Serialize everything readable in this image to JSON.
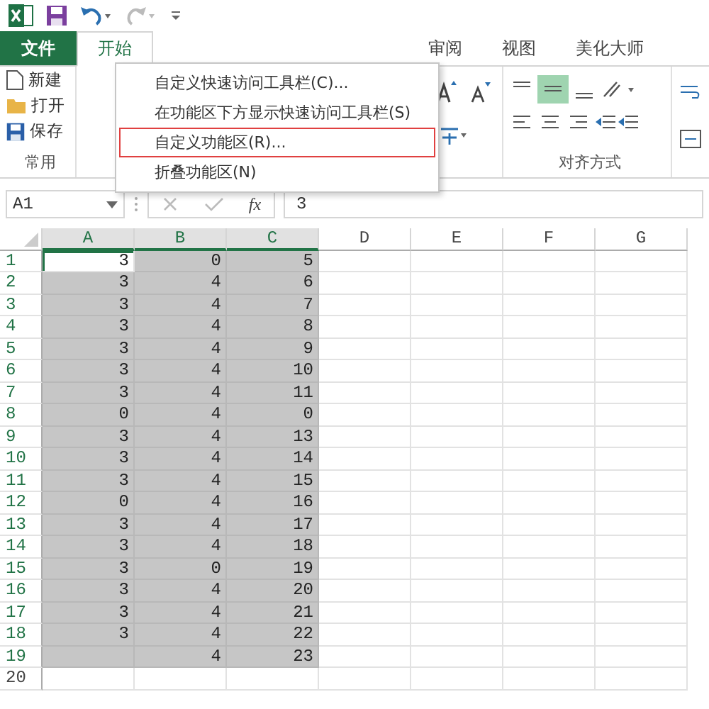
{
  "tabs": [
    {
      "label": "文件",
      "kind": "file",
      "selected": false
    },
    {
      "label": "开始",
      "kind": "tab",
      "selected": true
    },
    {
      "label": "审阅",
      "kind": "tab",
      "selected": false
    },
    {
      "label": "视图",
      "kind": "tab",
      "selected": false
    },
    {
      "label": "美化大师",
      "kind": "tab",
      "selected": false
    }
  ],
  "ribbon": {
    "common_group": {
      "items": [
        {
          "label": "新建",
          "kind": "new"
        },
        {
          "label": "打开",
          "kind": "open"
        },
        {
          "label": "保存",
          "kind": "save"
        }
      ],
      "label": "常用"
    },
    "align_group": {
      "label": "对齐方式"
    }
  },
  "context_menu": [
    {
      "label": "自定义快速访问工具栏(C)...",
      "selected": false
    },
    {
      "label": "在功能区下方显示快速访问工具栏(S)",
      "selected": false
    },
    {
      "label": "自定义功能区(R)...",
      "selected": true
    },
    {
      "label": "折叠功能区(N)",
      "selected": false
    }
  ],
  "formula_bar": {
    "name_box": "A1",
    "fx": "fx",
    "value": "3"
  },
  "sheet": {
    "columns": [
      {
        "label": "A",
        "selected": true
      },
      {
        "label": "B",
        "selected": true
      },
      {
        "label": "C",
        "selected": true
      },
      {
        "label": "D",
        "selected": false
      },
      {
        "label": "E",
        "selected": false
      },
      {
        "label": "F",
        "selected": false
      },
      {
        "label": "G",
        "selected": false
      }
    ],
    "rows": [
      {
        "label": "1",
        "selected": true,
        "active": true,
        "cells": [
          "3",
          "0",
          "5"
        ]
      },
      {
        "label": "2",
        "selected": true,
        "active": false,
        "cells": [
          "3",
          "4",
          "6"
        ]
      },
      {
        "label": "3",
        "selected": true,
        "active": false,
        "cells": [
          "3",
          "4",
          "7"
        ]
      },
      {
        "label": "4",
        "selected": true,
        "active": false,
        "cells": [
          "3",
          "4",
          "8"
        ]
      },
      {
        "label": "5",
        "selected": true,
        "active": false,
        "cells": [
          "3",
          "4",
          "9"
        ]
      },
      {
        "label": "6",
        "selected": true,
        "active": false,
        "cells": [
          "3",
          "4",
          "10"
        ]
      },
      {
        "label": "7",
        "selected": true,
        "active": false,
        "cells": [
          "3",
          "4",
          "11"
        ]
      },
      {
        "label": "8",
        "selected": true,
        "active": false,
        "cells": [
          "0",
          "4",
          "0"
        ]
      },
      {
        "label": "9",
        "selected": true,
        "active": false,
        "cells": [
          "3",
          "4",
          "13"
        ]
      },
      {
        "label": "10",
        "selected": true,
        "active": false,
        "cells": [
          "3",
          "4",
          "14"
        ]
      },
      {
        "label": "11",
        "selected": true,
        "active": false,
        "cells": [
          "3",
          "4",
          "15"
        ]
      },
      {
        "label": "12",
        "selected": true,
        "active": false,
        "cells": [
          "0",
          "4",
          "16"
        ]
      },
      {
        "label": "13",
        "selected": true,
        "active": false,
        "cells": [
          "3",
          "4",
          "17"
        ]
      },
      {
        "label": "14",
        "selected": true,
        "active": false,
        "cells": [
          "3",
          "4",
          "18"
        ]
      },
      {
        "label": "15",
        "selected": true,
        "active": false,
        "cells": [
          "3",
          "0",
          "19"
        ]
      },
      {
        "label": "16",
        "selected": true,
        "active": false,
        "cells": [
          "3",
          "4",
          "20"
        ]
      },
      {
        "label": "17",
        "selected": true,
        "active": false,
        "cells": [
          "3",
          "4",
          "21"
        ]
      },
      {
        "label": "18",
        "selected": true,
        "active": false,
        "cells": [
          "3",
          "4",
          "22"
        ]
      },
      {
        "label": "19",
        "selected": true,
        "active": false,
        "cells": [
          "",
          "4",
          "23"
        ]
      },
      {
        "label": "20",
        "selected": false,
        "active": false,
        "cells": [
          "",
          "",
          ""
        ]
      }
    ]
  }
}
